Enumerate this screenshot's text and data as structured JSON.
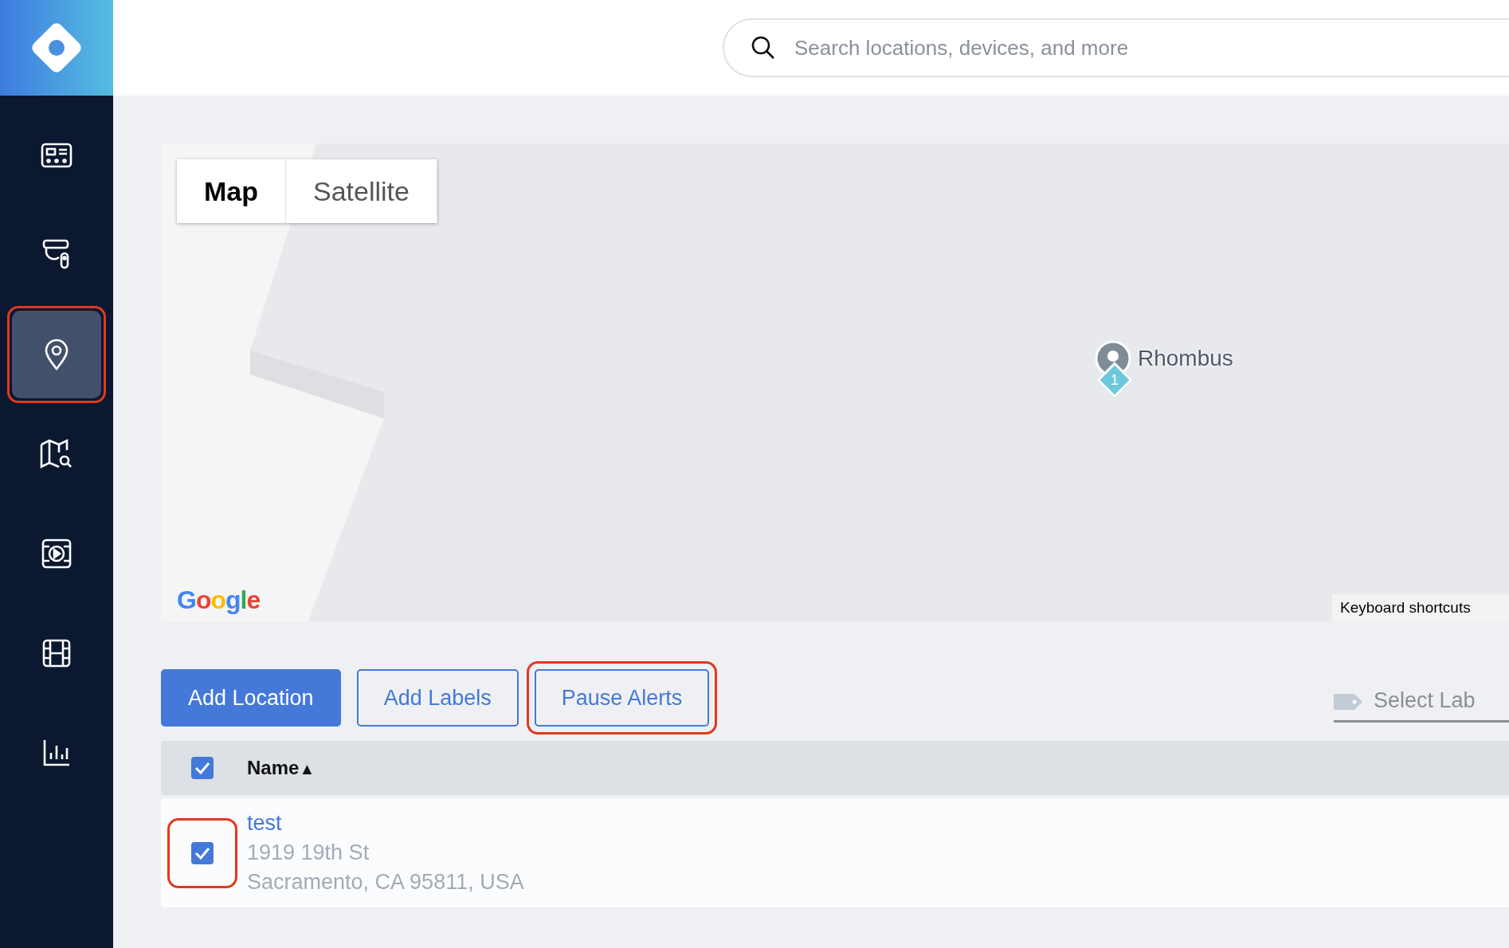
{
  "sidebar": {
    "items": [
      {
        "selected": false,
        "highlighted": false
      },
      {
        "selected": false,
        "highlighted": false
      },
      {
        "selected": true,
        "highlighted": true
      },
      {
        "selected": false,
        "highlighted": false
      },
      {
        "selected": false,
        "highlighted": false
      },
      {
        "selected": false,
        "highlighted": false
      },
      {
        "selected": false,
        "highlighted": false
      }
    ]
  },
  "search": {
    "placeholder": "Search locations, devices, and more"
  },
  "map": {
    "tabs": [
      {
        "label": "Map",
        "selected": true
      },
      {
        "label": "Satellite",
        "selected": false
      }
    ],
    "marker": {
      "label": "Rhombus",
      "count": "1"
    },
    "logo": "Google",
    "shortcuts": "Keyboard shortcuts"
  },
  "actions": [
    {
      "label": "Add Location",
      "kind": "primary",
      "highlighted": false
    },
    {
      "label": "Add Labels",
      "kind": "outline",
      "highlighted": false
    },
    {
      "label": "Pause Alerts",
      "kind": "outline",
      "highlighted": true
    }
  ],
  "label_filter": {
    "placeholder": "Select Lab"
  },
  "table": {
    "select_all": {
      "checked": true
    },
    "columns": [
      {
        "label": "Name",
        "sort_indicator": "▲"
      }
    ],
    "rows": [
      {
        "checked": true,
        "highlighted": true,
        "name": "test",
        "address_line_1": "1919 19th St",
        "address_line_2": "Sacramento, CA 95811, USA"
      }
    ]
  }
}
